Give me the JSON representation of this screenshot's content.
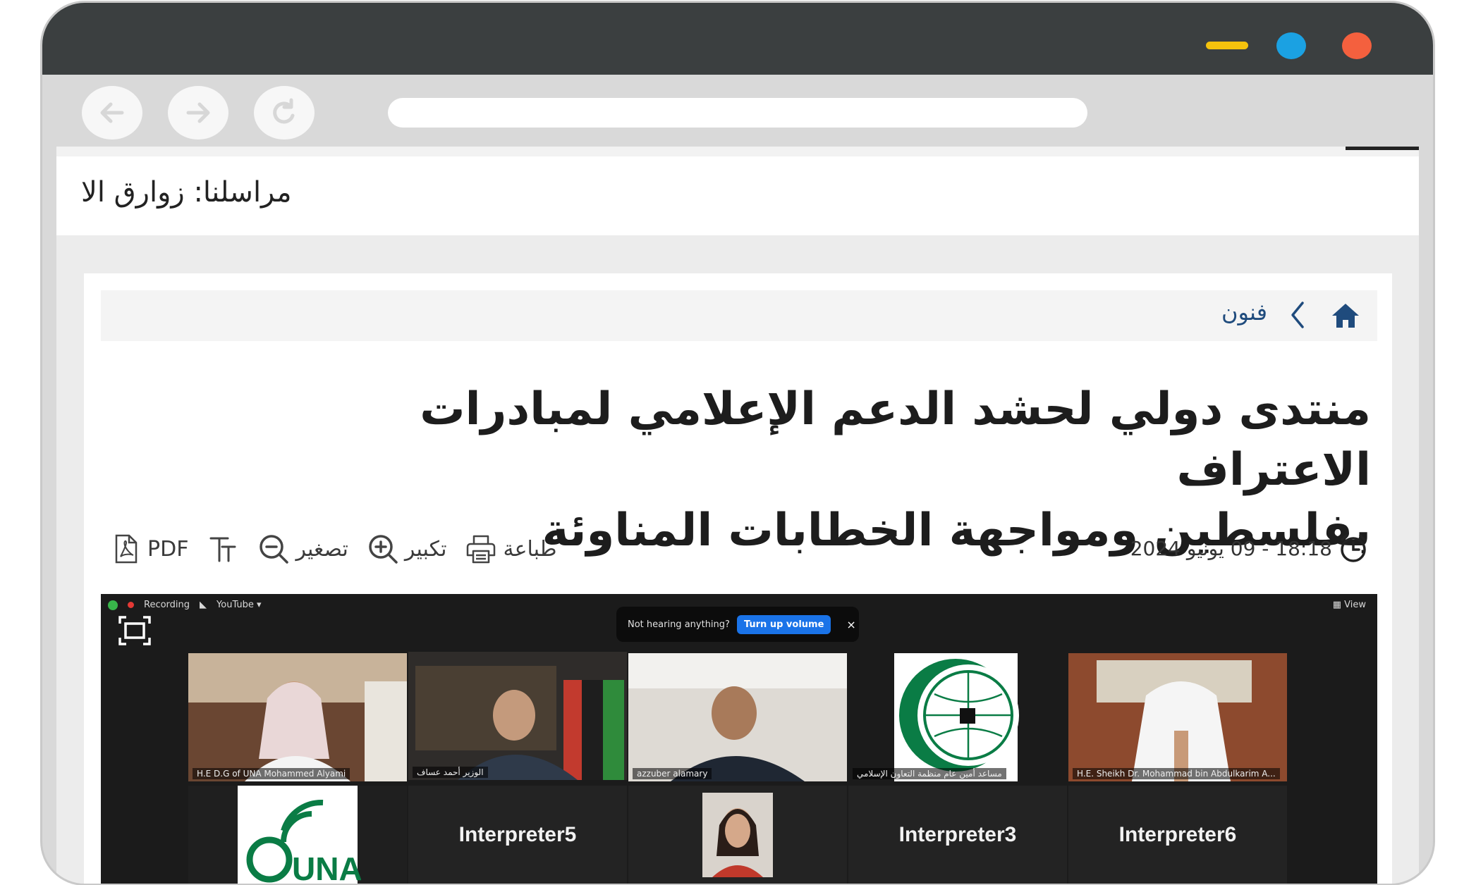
{
  "browser": {
    "controls": {
      "minimize_color": "#f4c20d",
      "maximize_color": "#1ba1e2",
      "close_color": "#f4603e"
    },
    "nav": [
      "back-icon",
      "forward-icon",
      "refresh-icon"
    ]
  },
  "ticker": {
    "text": "مراسلنا: زوارق الا"
  },
  "breadcrumb": {
    "home_icon": "home-icon",
    "section": "فنون"
  },
  "article": {
    "title_line1": "منتدى دولي لحشد الدعم الإعلامي لمبادرات الاعتراف",
    "title_line2": "بفلسطين ومواجهة الخطابات المناوئة",
    "datetime": "18:18 - 09 يونيو 2024"
  },
  "tools": {
    "print": "طباعة",
    "zoom_in": "تكبير",
    "zoom_out": "تصغير",
    "pdf": "PDF"
  },
  "video": {
    "recording": "Recording",
    "youtube": "YouTube ▾",
    "view": "View",
    "notice_text": "Not hearing anything?",
    "notice_button": "Turn up volume",
    "notice_close": "×",
    "participants": [
      "H.E D.G of UNA Mohammed Alyami",
      "الوزير أحمد عساف",
      "azzuber alamary",
      "مساعد أمين عام منظمة التعاون الإسلامي",
      "H.E. Sheikh Dr. Mohammad bin Abdulkarim A..."
    ],
    "interpreters": [
      "Interpreter5",
      "Interpreter3",
      "Interpreter6"
    ],
    "una_logo": "UNA"
  }
}
